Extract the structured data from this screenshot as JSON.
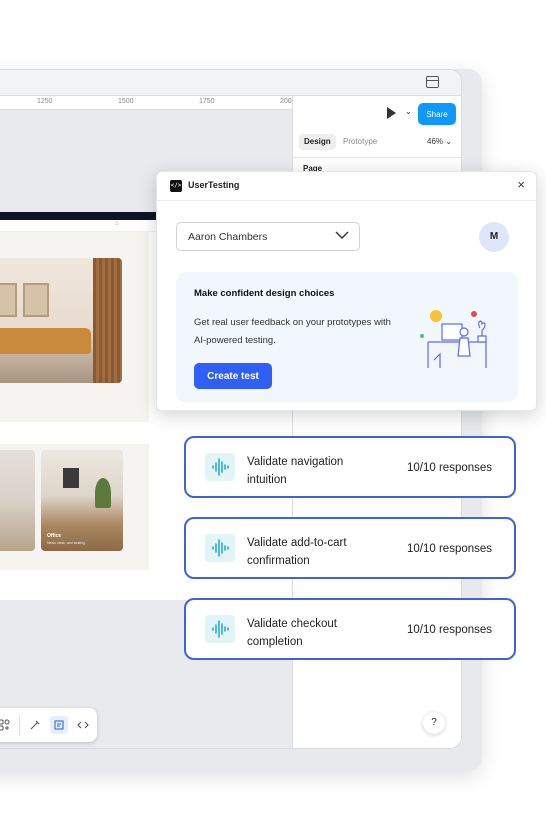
{
  "figma": {
    "ruler_ticks": [
      "1250",
      "1500",
      "1750",
      "200"
    ],
    "preview_subnav_icon": "cart-icon",
    "tile_label": "Office",
    "tile_sub": "Ideas, desk, and seating",
    "toolbar_icons": [
      "components-icon",
      "pen-icon",
      "frame-icon",
      "code-icon"
    ],
    "right_panel": {
      "share_label": "Share",
      "tab_design": "Design",
      "tab_prototype": "Prototype",
      "zoom": "46%",
      "page_label": "Page",
      "help_label": "?"
    }
  },
  "plugin": {
    "logo": "</>",
    "title": "UserTesting",
    "close_label": "×",
    "user_select": {
      "value": "Aaron Chambers"
    },
    "avatar_initial": "M",
    "promo": {
      "title": "Make confident design choices",
      "body": "Get real user feedback on your prototypes with AI-powered testing.",
      "button": "Create test"
    }
  },
  "tests": [
    {
      "title": "Validate navigation intuition",
      "responses": "10/10 responses"
    },
    {
      "title": "Validate add-to-cart confirmation",
      "responses": "10/10 responses"
    },
    {
      "title": "Validate checkout completion",
      "responses": "10/10 responses"
    }
  ],
  "colors": {
    "accent": "#3e63dd",
    "primary_button": "#2f5ff5",
    "share_button": "#0d99ff",
    "waveform": "#1ea8c6"
  }
}
